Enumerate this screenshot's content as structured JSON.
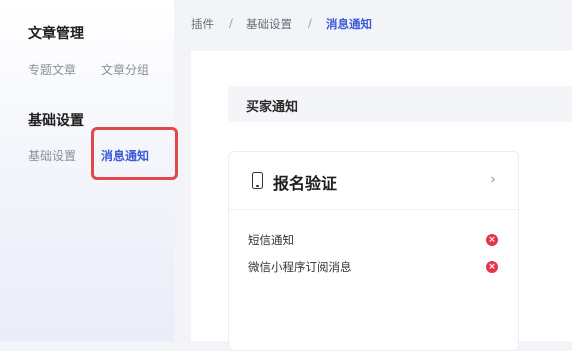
{
  "sidebar": {
    "groups": [
      {
        "title": "文章管理",
        "items": [
          {
            "label": "专题文章"
          },
          {
            "label": "文章分组"
          }
        ]
      },
      {
        "title": "基础设置",
        "items": [
          {
            "label": "基础设置"
          },
          {
            "label": "消息通知"
          }
        ]
      }
    ],
    "active_item": "消息通知"
  },
  "breadcrumb": {
    "items": [
      "插件",
      "基础设置",
      "消息通知"
    ],
    "separator": "/"
  },
  "main": {
    "section_title": "买家通知",
    "card": {
      "icon": "phone-icon",
      "title": "报名验证",
      "chevron": "›",
      "rows": [
        {
          "label": "短信通知",
          "status": "disabled",
          "status_icon": "×"
        },
        {
          "label": "微信小程序订阅消息",
          "status": "disabled",
          "status_icon": "×"
        }
      ]
    }
  },
  "colors": {
    "accent": "#3c5bd8",
    "highlight_border": "#e2474b",
    "status_off": "#e8344a"
  }
}
